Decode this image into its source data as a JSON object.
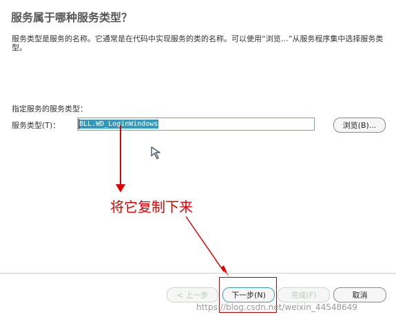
{
  "heading": "服务属于哪种服务类型？",
  "description": "服务类型是服务的名称。它通常是在代码中实现服务的类的名称。可以使用“浏览…”从服务程序集中选择服务类型。",
  "section_label": "指定服务的服务类型：",
  "field_label": "服务类型(T)：",
  "field_value": "BLL.WD_LoginWindows",
  "buttons": {
    "browse": "浏览(B)...",
    "prev": "< 上一步",
    "next": "下一步(N)",
    "finish": "完成(F)",
    "cancel": "取消"
  },
  "annotation": "将它复制下来",
  "watermark": "https://blog.csdn.net/weixin_44548649",
  "colors": {
    "annotation": "#dd0000",
    "selection": "#3399bb",
    "primary_border": "#3d9abb"
  }
}
